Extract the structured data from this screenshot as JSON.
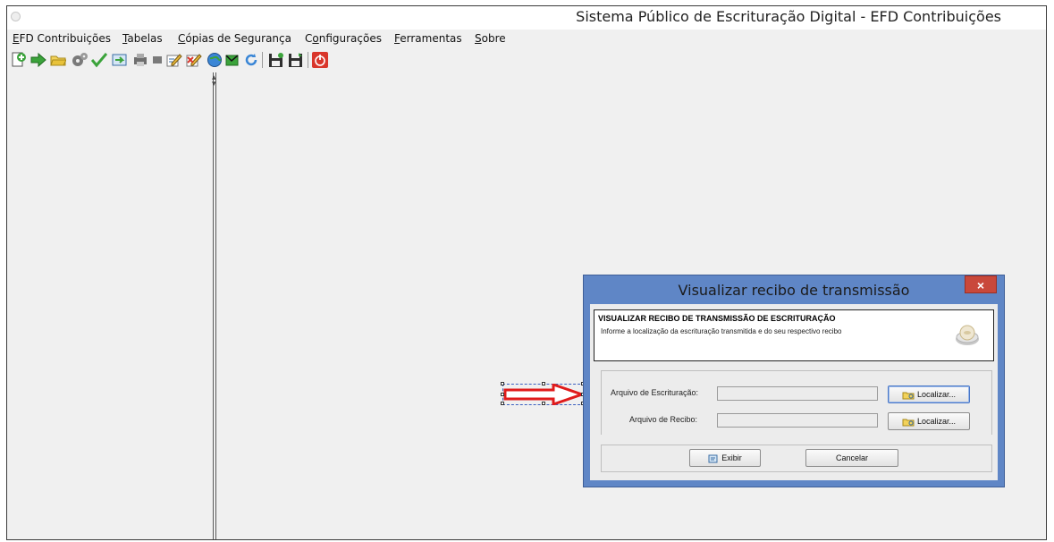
{
  "window": {
    "title": "Sistema Público de Escrituração Digital - EFD Contribuições"
  },
  "menu": [
    {
      "rest_before": "",
      "mnemonic": "E",
      "rest": "FD Contribuições"
    },
    {
      "rest_before": "",
      "mnemonic": "T",
      "rest": "abelas"
    },
    {
      "rest_before": "",
      "mnemonic": "C",
      "rest": "ópias de Segurança"
    },
    {
      "rest_before": "C",
      "mnemonic": "o",
      "rest": "nfigurações"
    },
    {
      "rest_before": "",
      "mnemonic": "F",
      "rest": "erramentas"
    },
    {
      "rest_before": "",
      "mnemonic": "S",
      "rest": "obre"
    }
  ],
  "toolbar": {
    "icons": [
      "new-document-icon",
      "import-arrow-icon",
      "open-folder-icon",
      "settings-gears-icon",
      "validate-check-icon",
      "sign-icon",
      "print-icon",
      "stop-icon",
      "edit-icon",
      "delete-icon",
      "transmit-globe-icon",
      "receipt-icon",
      "refresh-icon",
      "save-backup-icon",
      "restore-backup-icon",
      "exit-power-icon"
    ],
    "colors": {
      "green": "#3ba33b",
      "folder": "#e8c23a",
      "power": "#d9362b"
    }
  },
  "annotation": {
    "arrow_color": "#e01b1b"
  },
  "dialog": {
    "title": "Visualizar recibo de transmissão",
    "close_label": "×",
    "header_title": "VISUALIZAR RECIBO DE TRANSMISSÃO DE ESCRITURAÇÃO",
    "header_subtitle": "Informe a localização da escrituração transmitida e do seu respectivo recibo",
    "fields": [
      {
        "label": "Arquivo de Escrituração:",
        "value": "",
        "button": "Localizar..."
      },
      {
        "label": "Arquivo de Recibo:",
        "value": "",
        "button": "Localizar..."
      }
    ],
    "buttons": {
      "exibir": "Exibir",
      "cancelar": "Cancelar"
    },
    "colors": {
      "titlebar": "#5f86c6",
      "close": "#c9483b"
    }
  }
}
